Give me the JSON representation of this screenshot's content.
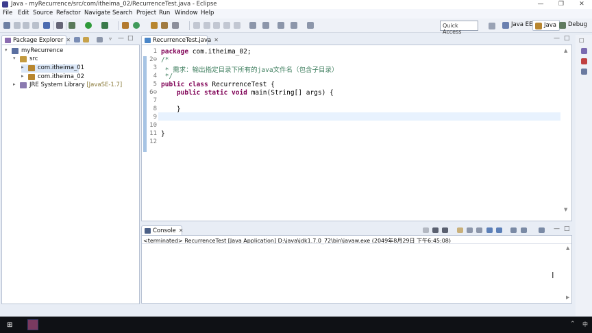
{
  "window": {
    "title": "Java - myRecurrence/src/com/itheima_02/RecurrenceTest.java - Eclipse",
    "min_icon": "minimize-icon",
    "max_icon": "maximize-icon",
    "close_icon": "close-icon"
  },
  "menu": [
    "File",
    "Edit",
    "Source",
    "Refactor",
    "Navigate",
    "Search",
    "Project",
    "Run",
    "Window",
    "Help"
  ],
  "toolbar": {
    "quick_access": "Quick Access",
    "perspectives": [
      "Java EE",
      "Java",
      "Debug"
    ]
  },
  "package_explorer": {
    "title": "Package Explorer",
    "tree": [
      {
        "arrow": "▾",
        "label": "myRecurrence",
        "extra": ""
      },
      {
        "arrow": "▾",
        "label": "src",
        "extra": ""
      },
      {
        "arrow": "▸",
        "label": "com.itheima_01",
        "extra": ""
      },
      {
        "arrow": "▸",
        "label": "com.itheima_02",
        "extra": ""
      },
      {
        "arrow": "▸",
        "label": "JRE System Library",
        "extra": "[JavaSE-1.7]"
      }
    ]
  },
  "editor": {
    "tab": "RecurrenceTest.java",
    "line_numbers": [
      "1",
      "2⊖",
      "3",
      "4",
      "5",
      "6⊖",
      "7",
      "8",
      "9",
      "10",
      "11",
      "12"
    ],
    "lines": [
      "package com.itheima_02;",
      "/*",
      " * 需求：输出指定目录下所有的java文件名（包含子目录）",
      " */",
      "public class RecurrenceTest {",
      "    public static void main(String[] args) {",
      "",
      "    }",
      "",
      "",
      "}",
      ""
    ]
  },
  "console": {
    "title": "Console",
    "status": "<terminated> RecurrenceTest [Java Application] D:\\java\\jdk1.7.0_72\\bin\\javaw.exe (2049年8月29日 下午6:45:08)"
  },
  "colors": {
    "keyword": "#7f0055",
    "comment": "#3f7f5f",
    "current_line": "#e8f2fe",
    "taskbar": "#0f1115"
  }
}
